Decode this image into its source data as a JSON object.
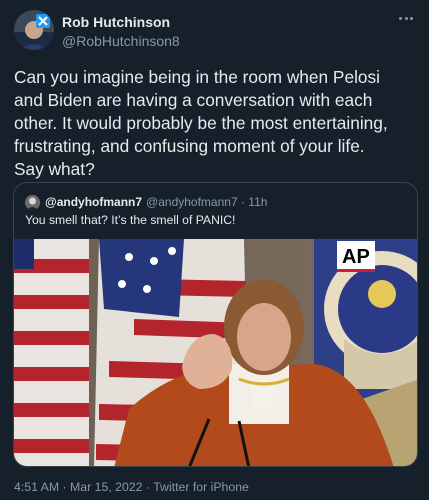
{
  "tweet": {
    "author_name": "Rob Hutchinson",
    "author_handle": "@RobHutchinson8",
    "body": "Can you imagine being in the room when Pelosi\nand Biden are having a conversation with each\nother. It would probably be the most entertaining,\nfrustrating, and confusing moment of your life.\nSay what?",
    "footer": "4:51 AM · Mar 15, 2022 · Twitter for iPhone"
  },
  "quoted_tweet": {
    "author_name": "@andyhofmann7",
    "author_handle": "@andyhofmann7",
    "time": "11h",
    "text": "You smell that? It’s the smell of PANIC!",
    "media_badge": "AP"
  },
  "colors": {
    "background": "#15202b",
    "text_primary": "#e7e9ea",
    "text_secondary": "#8b98a5",
    "border": "#38444d",
    "suit_orange": "#b34a1c"
  },
  "icons": {
    "menu": "more-horizontal-icon"
  }
}
